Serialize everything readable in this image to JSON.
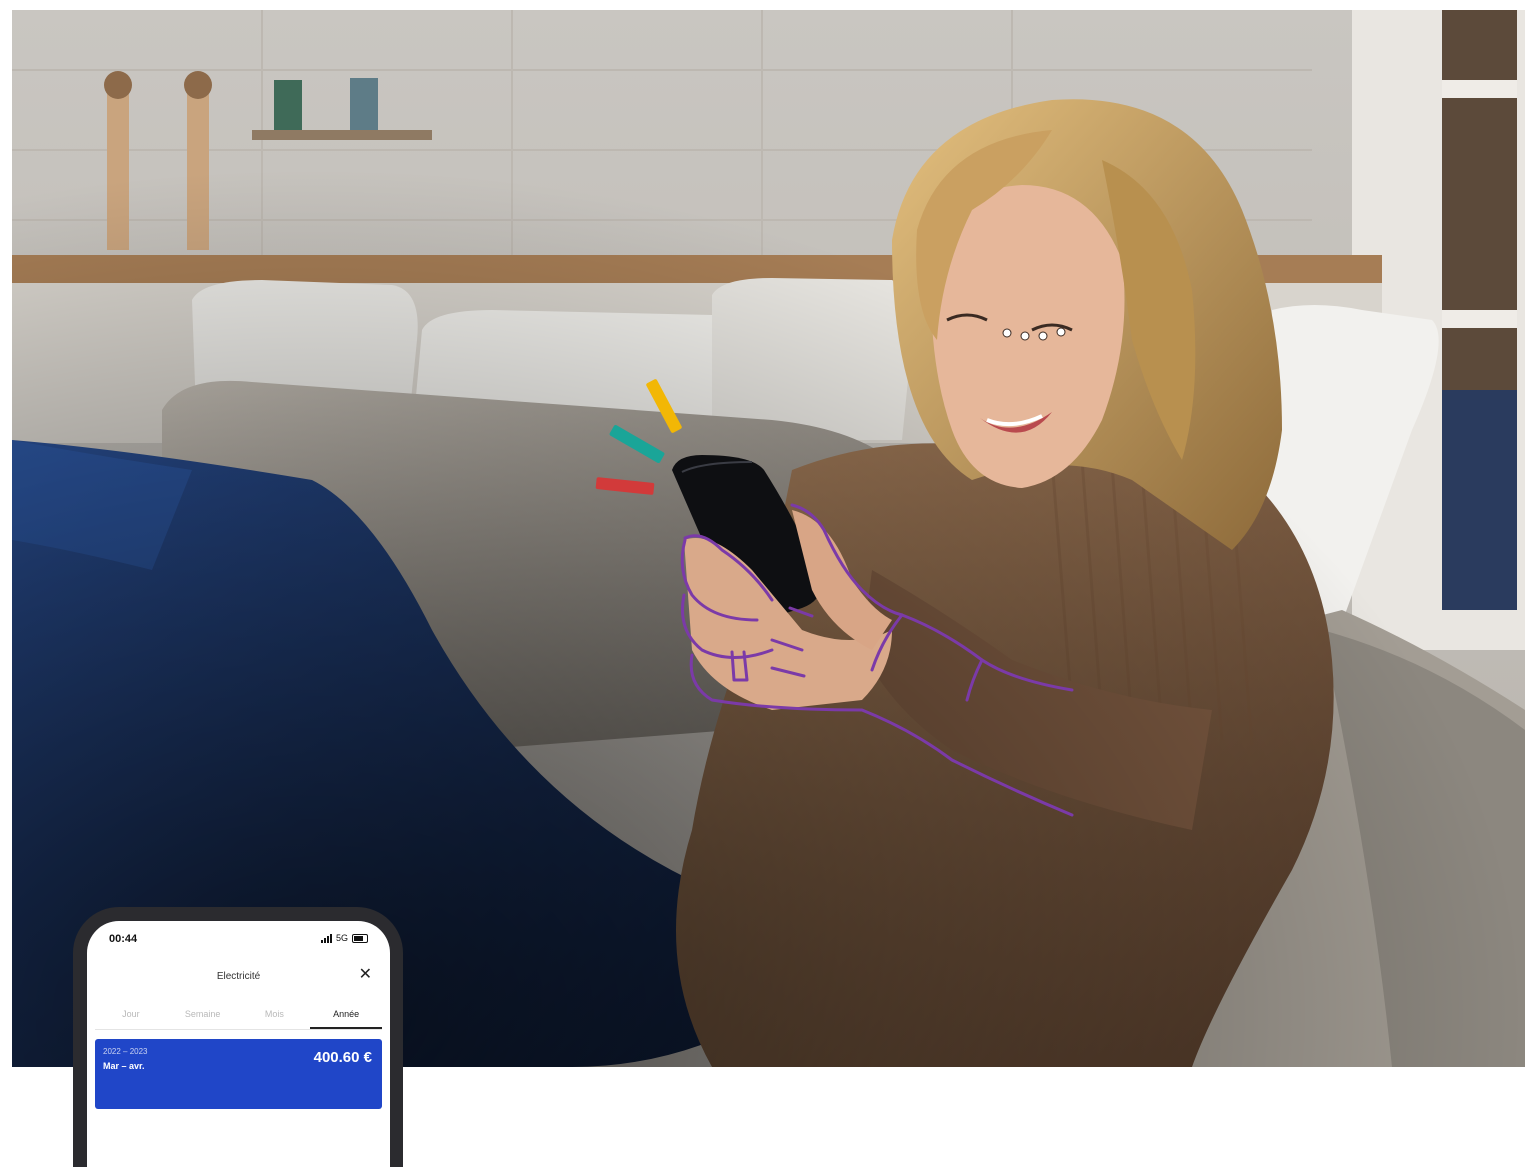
{
  "image": {
    "description_colors": {
      "wall": "#cfcac3",
      "sofa": "#b7b0a6",
      "sweater": "#8a6446",
      "jeans": "#1d3b74",
      "hair": "#d2a86a",
      "hand_outline": "#7b3aa8",
      "accent_yellow": "#f2b705",
      "accent_teal": "#1aa598",
      "accent_red": "#d23a3a"
    }
  },
  "phone_mockup": {
    "status_time": "00:44",
    "status_network": "5G",
    "title": "Electricité",
    "close_label": "✕",
    "tabs": [
      {
        "label": "Jour",
        "active": false
      },
      {
        "label": "Semaine",
        "active": false
      },
      {
        "label": "Mois",
        "active": false
      },
      {
        "label": "Année",
        "active": true
      }
    ],
    "card": {
      "years": "2022 – 2023",
      "months": "Mar – avr.",
      "amount": "400.60 €"
    },
    "card_color": "#2046c8"
  }
}
